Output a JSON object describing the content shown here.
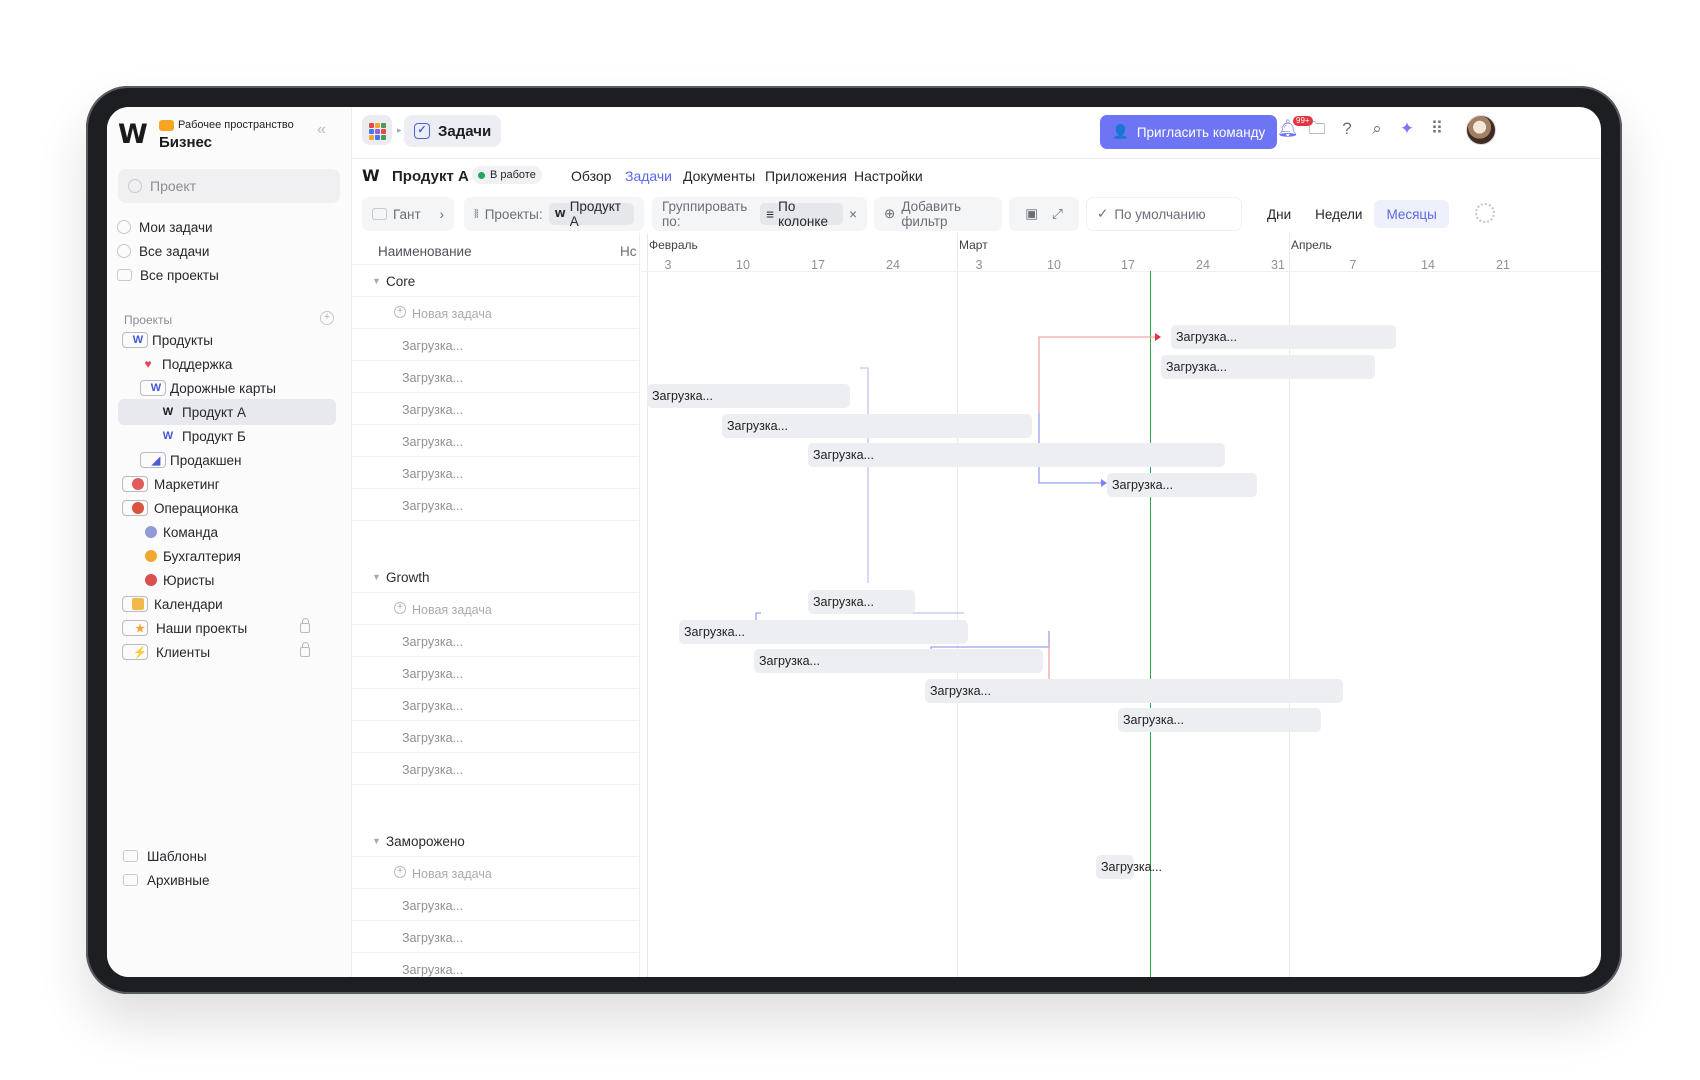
{
  "workspace": {
    "label": "Рабочее пространство",
    "name": "Бизнес"
  },
  "sidebar": {
    "search_placeholder": "Проект",
    "items": [
      {
        "label": "Мои задачи"
      },
      {
        "label": "Все задачи"
      },
      {
        "label": "Все проекты"
      }
    ],
    "projects_label": "Проекты",
    "tree": [
      {
        "label": "Продукты"
      },
      {
        "label": "Поддержка"
      },
      {
        "label": "Дорожные карты"
      },
      {
        "label": "Продукт А"
      },
      {
        "label": "Продукт Б"
      },
      {
        "label": "Продакшен"
      },
      {
        "label": "Маркетинг"
      },
      {
        "label": "Операционка"
      },
      {
        "label": "Команда"
      },
      {
        "label": "Бухгалтерия"
      },
      {
        "label": "Юристы"
      },
      {
        "label": "Календари"
      },
      {
        "label": "Наши проекты"
      },
      {
        "label": "Клиенты"
      }
    ],
    "bottom": [
      {
        "label": "Шаблоны"
      },
      {
        "label": "Архивные"
      }
    ]
  },
  "header": {
    "tab_label": "Задачи",
    "invite_label": "Пригласить команду",
    "notification_count": "99+"
  },
  "project": {
    "name": "Продукт А",
    "status": "В работе",
    "tabs": [
      "Обзор",
      "Задачи",
      "Документы",
      "Приложения",
      "Настройки"
    ],
    "active_tab": "Задачи"
  },
  "toolbar": {
    "view": "Гант",
    "projects_label": "Проекты:",
    "project_chip": "Продукт А",
    "group_label": "Группировать по:",
    "group_chip": "По колонке",
    "add_filter": "Добавить фильтр",
    "sort": "По умолчанию",
    "scales": [
      "Дни",
      "Недели",
      "Месяцы"
    ],
    "active_scale": "Месяцы"
  },
  "table": {
    "col_name": "Наименование",
    "col_short": "Нс",
    "new_task": "Новая задача",
    "loading": "Загрузка...",
    "groups": [
      {
        "name": "Core",
        "rows": 6
      },
      {
        "name": "Growth",
        "rows": 5
      },
      {
        "name": "Заморожено",
        "rows": 3
      }
    ]
  },
  "gantt": {
    "months": [
      {
        "label": "Февраль"
      },
      {
        "label": "Март"
      },
      {
        "label": "Апрель"
      }
    ],
    "days": [
      "3",
      "10",
      "17",
      "24",
      "3",
      "10",
      "17",
      "24",
      "31",
      "7",
      "14",
      "21"
    ],
    "today": "Mar 19",
    "colors": {
      "today": "#28a84a",
      "blocked": "#e5343e",
      "link": "#7b83f2"
    },
    "tasks": [
      {
        "label": "Загрузка...",
        "start": "Mar 21",
        "end": "Apr 11"
      },
      {
        "label": "Загрузка...",
        "start": "Mar 20",
        "end": "Apr 9"
      },
      {
        "label": "Загрузка...",
        "start": "Feb 1",
        "end": "Feb 20"
      },
      {
        "label": "Загрузка...",
        "start": "Feb 8",
        "end": "Mar 8"
      },
      {
        "label": "Загрузка...",
        "start": "Feb 16",
        "end": "Mar 26"
      },
      {
        "label": "Загрузка...",
        "start": "Mar 15",
        "end": "Mar 29"
      },
      {
        "label": "Загрузка...",
        "start": "Feb 16",
        "end": "Feb 26"
      },
      {
        "label": "Загрузка...",
        "start": "Feb 4",
        "end": "Mar 2"
      },
      {
        "label": "Загрузка...",
        "start": "Feb 11",
        "end": "Mar 9"
      },
      {
        "label": "Загрузка...",
        "start": "Feb 27",
        "end": "Apr 6"
      },
      {
        "label": "Загрузка...",
        "start": "Mar 16",
        "end": "Apr 4"
      },
      {
        "label": "Загрузка...",
        "start": "Mar 14",
        "end": "Mar 16"
      }
    ]
  }
}
